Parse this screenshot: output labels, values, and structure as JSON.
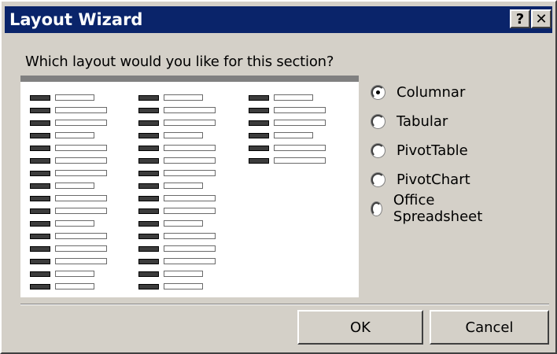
{
  "dialog": {
    "title": "Layout Wizard",
    "help_label": "?",
    "close_label": "✕",
    "prompt": "Which layout would you like for this section?"
  },
  "preview": {
    "columns": [
      [
        80,
        96,
        96,
        80,
        96,
        96,
        96,
        80,
        96,
        96,
        80,
        96,
        96,
        96,
        80,
        80
      ],
      [
        80,
        96,
        96,
        80,
        96,
        96,
        96,
        80,
        96,
        96,
        80,
        96,
        96,
        96,
        80,
        80
      ],
      [
        80,
        96,
        96,
        80,
        96,
        96
      ]
    ]
  },
  "layout_options": [
    {
      "label": "Columnar",
      "checked": true
    },
    {
      "label": "Tabular",
      "checked": false
    },
    {
      "label": "PivotTable",
      "checked": false
    },
    {
      "label": "PivotChart",
      "checked": false
    },
    {
      "label": "Office Spreadsheet",
      "checked": false
    }
  ],
  "buttons": {
    "ok": "OK",
    "cancel": "Cancel"
  },
  "colors": {
    "titlebar": "#0a246a",
    "face": "#d4d0c8"
  }
}
